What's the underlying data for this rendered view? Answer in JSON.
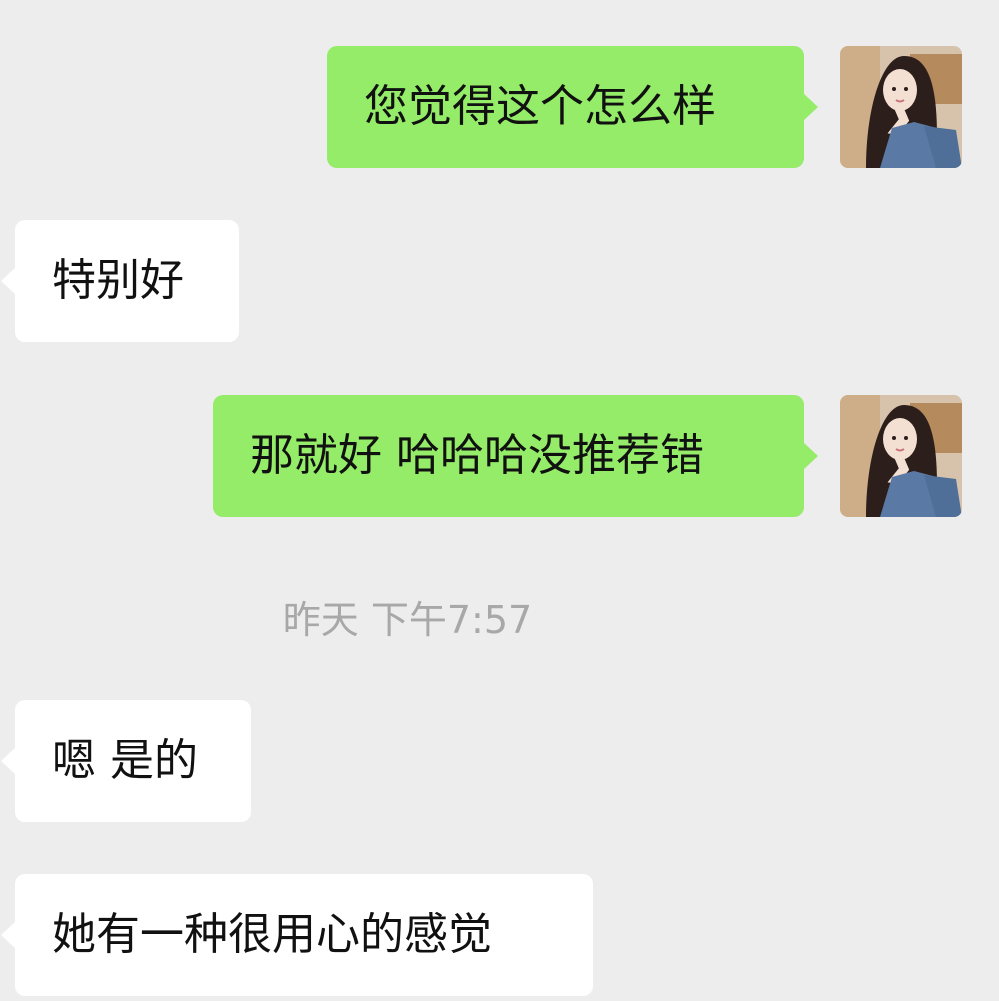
{
  "chat": {
    "messages": [
      {
        "side": "out",
        "text": "您觉得这个怎么样"
      },
      {
        "side": "in",
        "text": "特别好"
      },
      {
        "side": "out",
        "text": "那就好 哈哈哈没推荐错"
      },
      {
        "side": "in",
        "text": "嗯 是的"
      },
      {
        "side": "in",
        "text": "她有一种很用心的感觉"
      }
    ],
    "timestamp": "昨天 下午7:57"
  },
  "colors": {
    "background": "#ededed",
    "outgoing_bubble": "#95ec69",
    "incoming_bubble": "#ffffff",
    "timestamp_text": "#a8a8a8"
  },
  "icons": {
    "user_avatar": "avatar-photo-icon"
  }
}
